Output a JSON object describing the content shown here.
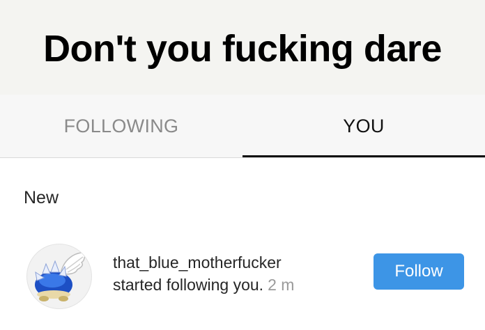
{
  "caption": {
    "text": "Don't you fucking dare"
  },
  "tabs": [
    {
      "label": "FOLLOWING",
      "active": false
    },
    {
      "label": "YOU",
      "active": true
    }
  ],
  "section": {
    "heading": "New"
  },
  "notification": {
    "username": "that_blue_motherfucker",
    "activity": "started following you.",
    "time": "2 m",
    "avatar_icon": "blue-spiny-shell-icon",
    "button_label": "Follow"
  },
  "colors": {
    "accent": "#3d95e6",
    "caption_bg": "#f4f4f1",
    "tabbar_bg": "#f7f7f7"
  }
}
